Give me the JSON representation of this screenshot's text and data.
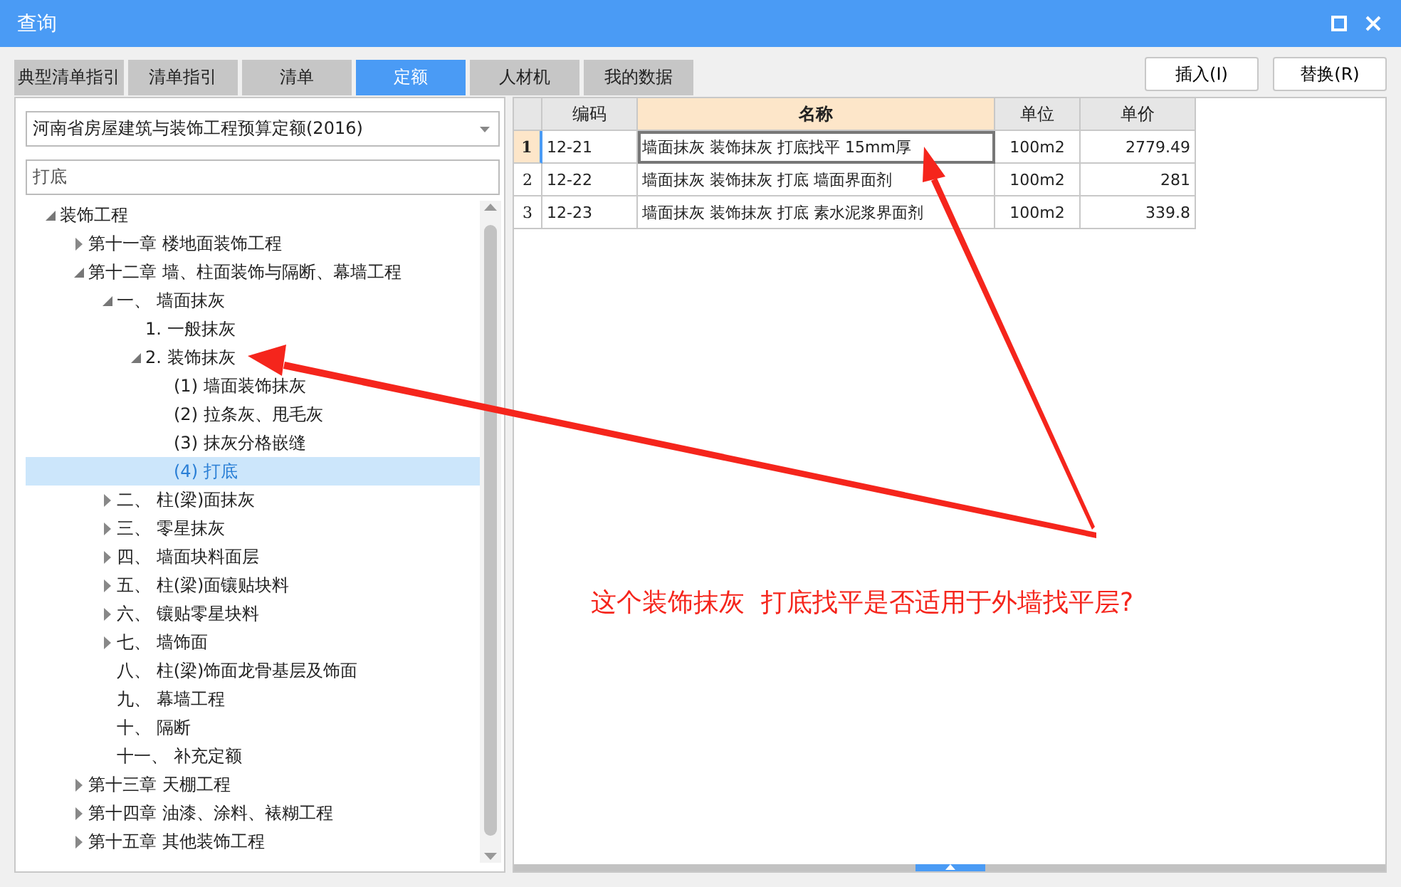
{
  "window": {
    "title": "查询"
  },
  "tabs": [
    {
      "label": "典型清单指引",
      "selected": false
    },
    {
      "label": "清单指引",
      "selected": false
    },
    {
      "label": "清单",
      "selected": false
    },
    {
      "label": "定额",
      "selected": true
    },
    {
      "label": "人材机",
      "selected": false
    },
    {
      "label": "我的数据",
      "selected": false
    }
  ],
  "buttons": [
    "插入(I)",
    "替换(R)"
  ],
  "library_select": {
    "value": "河南省房屋建筑与装饰工程预算定额(2016)"
  },
  "search": {
    "value": "打底"
  },
  "tree": [
    {
      "label": "装饰工程",
      "expanded": true,
      "selected": false,
      "children": [
        {
          "label": "第十一章 楼地面装饰工程",
          "expanded": false,
          "selected": false
        },
        {
          "label": "第十二章 墙、柱面装饰与隔断、幕墙工程",
          "expanded": true,
          "selected": false,
          "children": [
            {
              "label": "一、 墙面抹灰",
              "expanded": true,
              "selected": false,
              "children": [
                {
                  "label": "1. 一般抹灰",
                  "selected": false
                },
                {
                  "label": "2. 装饰抹灰",
                  "expanded": true,
                  "selected": false,
                  "children": [
                    {
                      "label": "(1) 墙面装饰抹灰",
                      "selected": false
                    },
                    {
                      "label": "(2) 拉条灰、甩毛灰",
                      "selected": false
                    },
                    {
                      "label": "(3) 抹灰分格嵌缝",
                      "selected": false
                    },
                    {
                      "label": "(4) 打底",
                      "selected": true
                    }
                  ]
                }
              ]
            },
            {
              "label": "二、 柱(梁)面抹灰",
              "expanded": false,
              "selected": false
            },
            {
              "label": "三、 零星抹灰",
              "expanded": false,
              "selected": false
            },
            {
              "label": "四、 墙面块料面层",
              "expanded": false,
              "selected": false
            },
            {
              "label": "五、 柱(梁)面镶贴块料",
              "expanded": false,
              "selected": false
            },
            {
              "label": "六、 镶贴零星块料",
              "expanded": false,
              "selected": false
            },
            {
              "label": "七、 墙饰面",
              "expanded": false,
              "selected": false
            },
            {
              "label": "八、 柱(梁)饰面龙骨基层及饰面",
              "selected": false
            },
            {
              "label": "九、 幕墙工程",
              "selected": false
            },
            {
              "label": "十、 隔断",
              "selected": false
            },
            {
              "label": "十一、 补充定额",
              "selected": false
            }
          ]
        },
        {
          "label": "第十三章 天棚工程",
          "expanded": false,
          "selected": false
        },
        {
          "label": "第十四章 油漆、涂料、裱糊工程",
          "expanded": false,
          "selected": false
        },
        {
          "label": "第十五章 其他装饰工程",
          "expanded": false,
          "selected": false
        }
      ]
    }
  ],
  "table": {
    "columns": [
      {
        "label": "编码",
        "selected": false
      },
      {
        "label": "名称",
        "selected": true
      },
      {
        "label": "单位",
        "selected": false
      },
      {
        "label": "单价",
        "selected": false
      }
    ],
    "rows": [
      {
        "number": "1",
        "selected": true,
        "cells": [
          "12-21",
          "墙面抹灰 装饰抹灰 打底找平 15mm厚",
          "100m2",
          "2779.49"
        ]
      },
      {
        "number": "2",
        "selected": false,
        "cells": [
          "12-22",
          "墙面抹灰 装饰抹灰 打底 墙面界面剂",
          "100m2",
          "281"
        ]
      },
      {
        "number": "3",
        "selected": false,
        "cells": [
          "12-23",
          "墙面抹灰 装饰抹灰 打底 素水泥浆界面剂",
          "100m2",
          "339.8"
        ]
      }
    ]
  },
  "annotation": {
    "text": "这个装饰抹灰  打底找平是否适用于外墙找平层?"
  }
}
